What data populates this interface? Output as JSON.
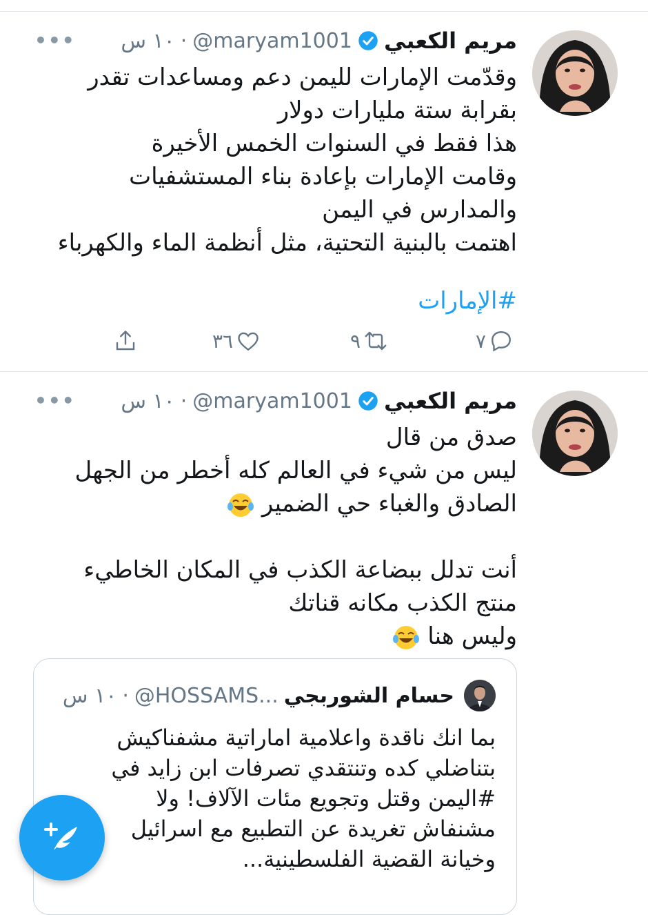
{
  "tweets": [
    {
      "name": "مريم الكعبي",
      "handle": "@maryam1001",
      "dot": "·",
      "time": "١٠ س",
      "lines": [
        "وقدّمت الإمارات لليمن دعم ومساعدات  تقدر",
        "بقرابة ستة مليارات دولار",
        "هذا فقط في السنوات الخمس الأخيرة",
        "وقامت الإمارات بإعادة بناء المستشفيات",
        "والمدارس في اليمن",
        "اهتمت بالبنية التحتية، مثل أنظمة الماء والكهرباء"
      ],
      "hashtag": "#الإمارات",
      "reply_count": "٧",
      "retweet_count": "٩",
      "like_count": "٣٦"
    },
    {
      "name": "مريم الكعبي",
      "handle": "@maryam1001",
      "dot": "·",
      "time": "١٠ س",
      "lines": [
        "صدق من قال",
        "ليس من شيء في العالم كله أخطر من الجهل",
        "الصادق والغباء حي الضمير",
        "",
        "أنت تدلل ببضاعة الكذب في المكان الخاطيء",
        "منتج الكذب مكانه قناتك",
        "وليس هنا"
      ],
      "quoted": {
        "name": "حسام الشوربجي",
        "handle": "@HOSSAMS...",
        "dot": "·",
        "time": "١٠ س",
        "lines": [
          "بما انك ناقدة واعلامية اماراتية مشفناكيش",
          "بتناضلي كده وتنتقدي تصرفات ابن زايد في",
          "#اليمن وقتل وتجويع مئات الآلاف! ولا",
          "مشنفاش تغريدة عن التطبيع مع اسرائيل",
          "وخيانة القضية الفلسطينية..."
        ]
      }
    }
  ],
  "icons": {
    "verified": "verified-badge-icon",
    "more": "more-dots-icon",
    "reply": "reply-icon",
    "retweet": "retweet-icon",
    "like": "heart-icon",
    "share": "share-icon",
    "emoji": "tears-of-joy-emoji",
    "compose": "compose-tweet-icon"
  },
  "colors": {
    "accent": "#1da1f2",
    "secondary_text": "#657786",
    "divider": "#dfe3e7"
  }
}
